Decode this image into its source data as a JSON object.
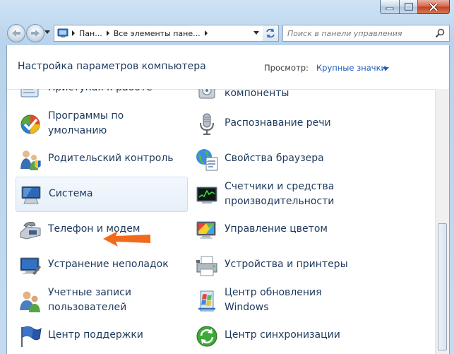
{
  "window": {
    "minimize": "minimize",
    "maximize": "maximize",
    "close": "close"
  },
  "address": {
    "crumb1": "Пан...",
    "crumb2": "Все элементы пане...",
    "search_placeholder": "Поиск в панели управления"
  },
  "header": {
    "title": "Настройка параметров компьютера",
    "view_label": "Просмотр:",
    "view_value": "Крупные значки"
  },
  "items_left": [
    {
      "label": "Приступая к работе",
      "icon": "getting-started-icon"
    },
    {
      "label": "Программы по",
      "label2": "умолчанию",
      "icon": "default-programs-icon"
    },
    {
      "label": "Родительский контроль",
      "icon": "parental-control-icon"
    },
    {
      "label": "Система",
      "icon": "system-icon"
    },
    {
      "label": "Телефон и модем",
      "icon": "phone-modem-icon"
    },
    {
      "label": "Устранение неполадок",
      "icon": "troubleshooting-icon"
    },
    {
      "label": "Учетные записи",
      "label2": "пользователей",
      "icon": "user-accounts-icon"
    },
    {
      "label": "Центр поддержки",
      "icon": "action-center-icon"
    }
  ],
  "items_right": [
    {
      "label": "компоненты",
      "icon": "programs-features-icon"
    },
    {
      "label": "Распознавание речи",
      "icon": "microphone-icon"
    },
    {
      "label": "Свойства браузера",
      "icon": "internet-options-icon"
    },
    {
      "label": "Счетчики и средства",
      "label2": "производительности",
      "icon": "performance-icon"
    },
    {
      "label": "Управление цветом",
      "icon": "color-management-icon"
    },
    {
      "label": "Устройства и принтеры",
      "icon": "printer-icon"
    },
    {
      "label": "Центр обновления",
      "label2": "Windows",
      "icon": "windows-update-icon"
    },
    {
      "label": "Центр синхронизации",
      "icon": "sync-center-icon"
    }
  ],
  "colors": {
    "link": "#1e395b",
    "accent": "#1f5ab7",
    "arrow": "#f26a1b"
  }
}
